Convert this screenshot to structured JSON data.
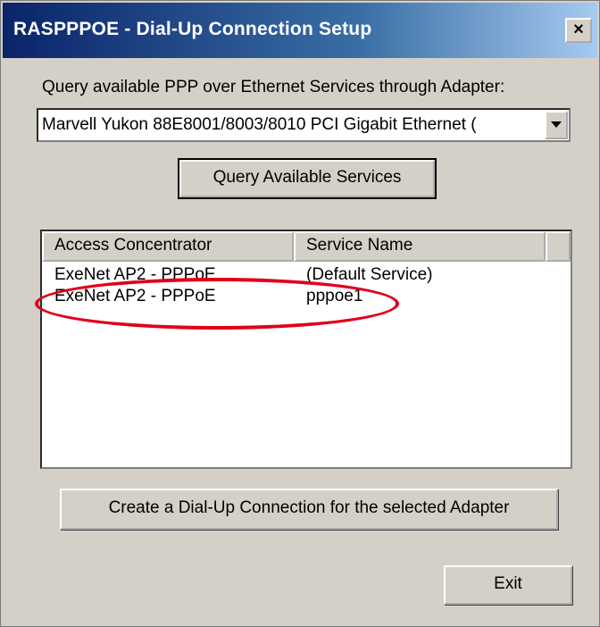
{
  "window": {
    "title": "RASPPPOE - Dial-Up Connection Setup",
    "close_label": "×"
  },
  "adapter": {
    "label": "Query available PPP over Ethernet Services through Adapter:",
    "selected": "Marvell Yukon 88E8001/8003/8010 PCI Gigabit Ethernet (",
    "dropdown_icon": "chevron-down-icon"
  },
  "buttons": {
    "query": "Query Available Services",
    "create": "Create a Dial-Up Connection for the selected Adapter",
    "exit": "Exit"
  },
  "services_list": {
    "columns": [
      "Access Concentrator",
      "Service Name"
    ],
    "rows": [
      {
        "concentrator": "ExeNet AP2 - PPPoE",
        "service": "(Default Service)"
      },
      {
        "concentrator": "ExeNet AP2 - PPPoE",
        "service": "pppoe1"
      }
    ]
  },
  "annotation": {
    "color": "#e0001a"
  }
}
